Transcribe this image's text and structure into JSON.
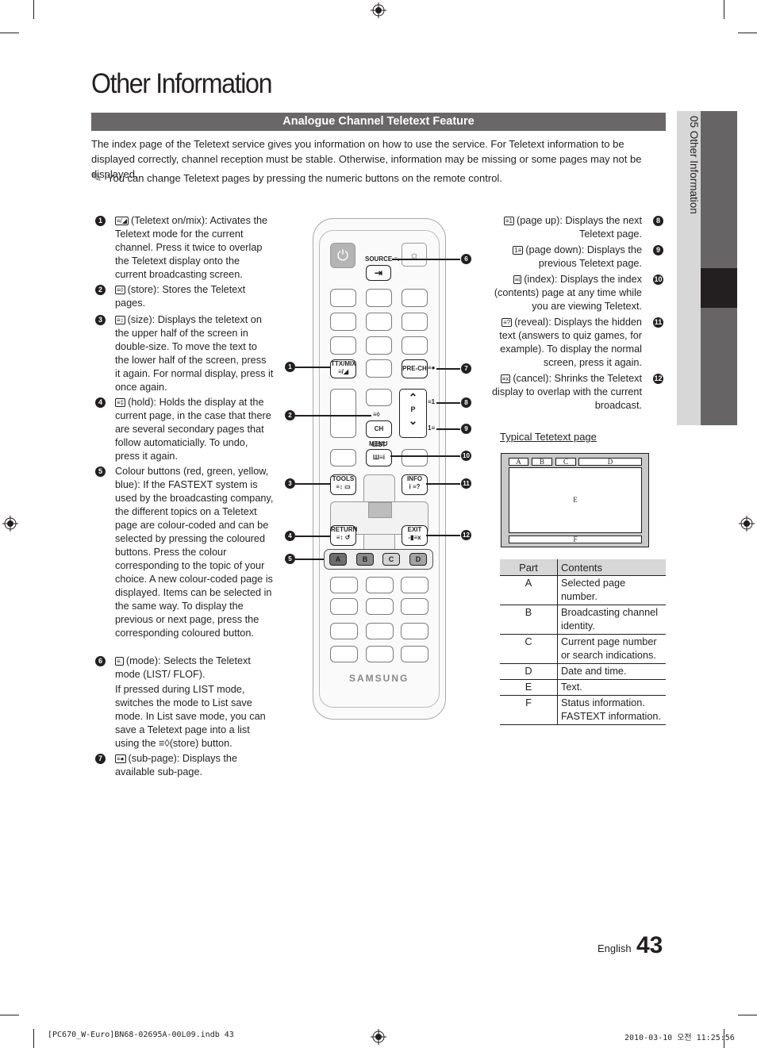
{
  "page": {
    "title": "Other Information",
    "section_title": "Analogue Channel Teletext Feature",
    "intro": "The index page of the Teletext service gives you information on how to use the service. For Teletext information to be displayed correctly, channel reception must be stable. Otherwise, information may be missing or some pages may not be displayed.",
    "note_icon": "✎",
    "note": "You can change Teletext pages by pressing the numeric buttons on the remote control.",
    "side_tab": "05   Other Information"
  },
  "left_items": [
    {
      "num": "1",
      "icon": "≡/◢",
      "text": "(Teletext on/mix): Activates the Teletext mode for the current channel. Press it twice to overlap the Teletext display onto the current broadcasting screen."
    },
    {
      "num": "2",
      "icon": "≡◊",
      "text": "(store): Stores the Teletext pages."
    },
    {
      "num": "3",
      "icon": "≡↕",
      "text": "(size): Displays the teletext on the upper half of the screen in double-size. To move the text to the lower half of the screen, press it again. For normal display, press it once again."
    },
    {
      "num": "4",
      "icon": "≡‡",
      "text": "(hold): Holds the display at the current page, in the case that there are several secondary pages that follow automaticially. To undo, press it again."
    },
    {
      "num": "5",
      "icon": "",
      "text": "Colour buttons (red, green, yellow, blue): If the FASTEXT system is used by the broadcasting company, the different topics on a Teletext page are colour-coded and can be selected by pressing the coloured buttons. Press the colour corresponding to the topic of your choice. A new colour-coded page is displayed. Items can be selected in the same way. To display the previous or next page, press the corresponding coloured button."
    },
    {
      "num": "6",
      "icon": "≡.",
      "text": "(mode): Selects the Teletext mode (LIST/ FLOF).",
      "extra": "If pressed during LIST mode, switches the mode to List save mode. In List save mode, you can save a Teletext page into a list using the ≡◊(store) button."
    },
    {
      "num": "7",
      "icon": "≡●",
      "text": "(sub-page): Displays the available sub-page."
    }
  ],
  "right_items": [
    {
      "num": "8",
      "icon": "≡1",
      "text": "(page up): Displays the next Teletext page."
    },
    {
      "num": "9",
      "icon": "1≡",
      "text": "(page down): Displays the previous Teletext page."
    },
    {
      "num": "10",
      "icon": "≡i",
      "text": "(index): Displays the index (contents) page at any time while you are viewing Teletext."
    },
    {
      "num": "11",
      "icon": "≡?",
      "text": "(reveal): Displays the hidden text (answers to quiz games, for example). To display the normal screen, press it again."
    },
    {
      "num": "12",
      "icon": "≡x",
      "text": "(cancel): Shrinks the Teletext display to overlap with the current broadcast."
    }
  ],
  "remote": {
    "source_label": "SOURCE ≡.",
    "source_icon": "⇥",
    "power_icon": "⏻",
    "light_icon": "☼",
    "ttx_label": "TTX/MIX",
    "ttx_sub": "≡/◢",
    "prech_label": "PRE-CH",
    "prech_side": "≡●",
    "store_side": "≡◊",
    "chlist_label": "CH LIST",
    "p_label": "P",
    "p_up": "⌃",
    "p_down": "⌄",
    "pup_side": "≡1",
    "pdown_side": "1≡",
    "menu_label": "MENU",
    "menu_sub": "Ш≡i",
    "tools_label": "TOOLS",
    "tools_sub": "≡↕ ▭",
    "info_label": "INFO",
    "info_sub": "i ≡?",
    "return_label": "RETURN",
    "return_sub": "≡↕ ↺",
    "exit_label": "EXIT",
    "exit_sub": "-▮≡x",
    "color_buttons": [
      {
        "label": "A",
        "color": "#6d6d6d"
      },
      {
        "label": "B",
        "color": "#8a8a8a"
      },
      {
        "label": "C",
        "color": "#d4d4d4"
      },
      {
        "label": "D",
        "color": "#a3a3a3"
      }
    ],
    "brand": "SAMSUNG",
    "callouts": [
      "1",
      "2",
      "3",
      "4",
      "5",
      "6",
      "7",
      "8",
      "9",
      "10",
      "11",
      "12"
    ]
  },
  "teletext_diagram": {
    "title": "Typical Tetetext page",
    "labels": {
      "A": "A",
      "B": "B",
      "C": "C",
      "D": "D",
      "E": "E",
      "F": "F"
    }
  },
  "parts_table": {
    "headers": [
      "Part",
      "Contents"
    ],
    "rows": [
      {
        "part": "A",
        "contents": "Selected page number."
      },
      {
        "part": "B",
        "contents": "Broadcasting channel identity."
      },
      {
        "part": "C",
        "contents": "Current page number or search indications."
      },
      {
        "part": "D",
        "contents": "Date and time."
      },
      {
        "part": "E",
        "contents": "Text."
      },
      {
        "part": "F",
        "contents": "Status information. FASTEXT information."
      }
    ]
  },
  "footer": {
    "language": "English",
    "page_number": "43",
    "slug_file": "[PC670_W-Euro]BN68-02695A-00L09.indb   43",
    "slug_date": "2010-03-10   오전 11:25:56"
  }
}
